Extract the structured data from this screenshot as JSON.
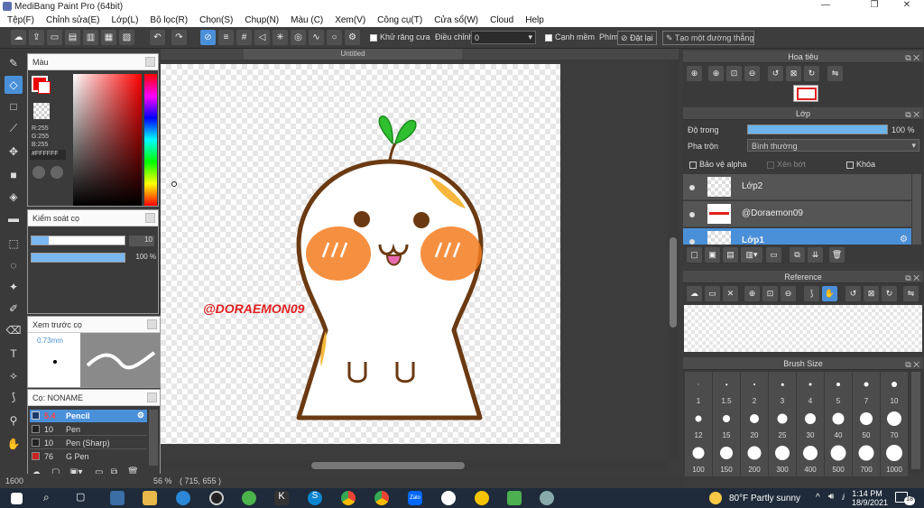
{
  "window": {
    "title": "MediBang Paint Pro (64bit)"
  },
  "menu": [
    "Tệp(F)",
    "Chỉnh sửa(E)",
    "Lớp(L)",
    "Bộ lọc(R)",
    "Chọn(S)",
    "Chụp(N)",
    "Màu (C)",
    "Xem(V)",
    "Công cụ(T)",
    "Cửa sổ(W)",
    "Cloud",
    "Help"
  ],
  "toolbar": {
    "antialias": "Khử răng cưa",
    "adjust_label": "Điều chỉnh",
    "adjust_value": "0",
    "sharp_edge": "Cạnh mềm",
    "key_label": "Phím",
    "reset_label": "Đặt lại",
    "ruler_label": "Tạo một đường thẳng"
  },
  "color_panel": {
    "title": "Màu",
    "r": "R:255",
    "g": "G:255",
    "b": "B:255",
    "hex": "#FFFFFF"
  },
  "brush_control": {
    "title": "Kiểm soát cọ",
    "size": "10",
    "opacity": "100 %"
  },
  "brush_preview": {
    "title": "Xem trước cọ",
    "size": "0.73mm"
  },
  "brush_list": {
    "title": "Cọ: NONAME",
    "items": [
      {
        "size": "5.4",
        "name": "Pencil",
        "color": "#1a3a6a"
      },
      {
        "size": "10",
        "name": "Pen",
        "color": "#2a2a2a"
      },
      {
        "size": "10",
        "name": "Pen (Sharp)",
        "color": "#2a2a2a"
      },
      {
        "size": "76",
        "name": "G Pen",
        "color": "#cc2222"
      }
    ]
  },
  "canvas": {
    "tab": "Untitled",
    "watermark": "@DORAEMON09"
  },
  "status": {
    "size": "1600",
    "zoom": "56 %",
    "coords": "( 715, 655 )"
  },
  "navigator": {
    "title": "Hoa tiêu"
  },
  "layers": {
    "title": "Lớp",
    "opacity_label": "Độ trong",
    "opacity_value": "100 %",
    "blend_label": "Pha trộn",
    "blend_value": "Bình thường",
    "protect_alpha": "Bảo vệ alpha",
    "clipping": "Xén bớt",
    "lock": "Khóa",
    "items": [
      {
        "name": "Lớp2"
      },
      {
        "name": "@Doraemon09"
      },
      {
        "name": "Lớp1"
      }
    ]
  },
  "reference": {
    "title": "Reference"
  },
  "brush_size": {
    "title": "Brush Size",
    "sizes": [
      "1",
      "1.5",
      "2",
      "3",
      "4",
      "5",
      "7",
      "10",
      "12",
      "15",
      "20",
      "25",
      "30",
      "40",
      "50",
      "70",
      "100",
      "150",
      "200",
      "300",
      "400",
      "500",
      "700",
      "1000"
    ]
  },
  "taskbar": {
    "weather": "80°F  Partly sunny",
    "time": "1:14 PM",
    "date": "18/9/2021",
    "notif": "18"
  },
  "colors": {
    "accent": "#4a90d9",
    "dark": "#3c3c3c",
    "orange": "#f47c20",
    "brown": "#6b3a12",
    "green": "#2fbf2f"
  }
}
